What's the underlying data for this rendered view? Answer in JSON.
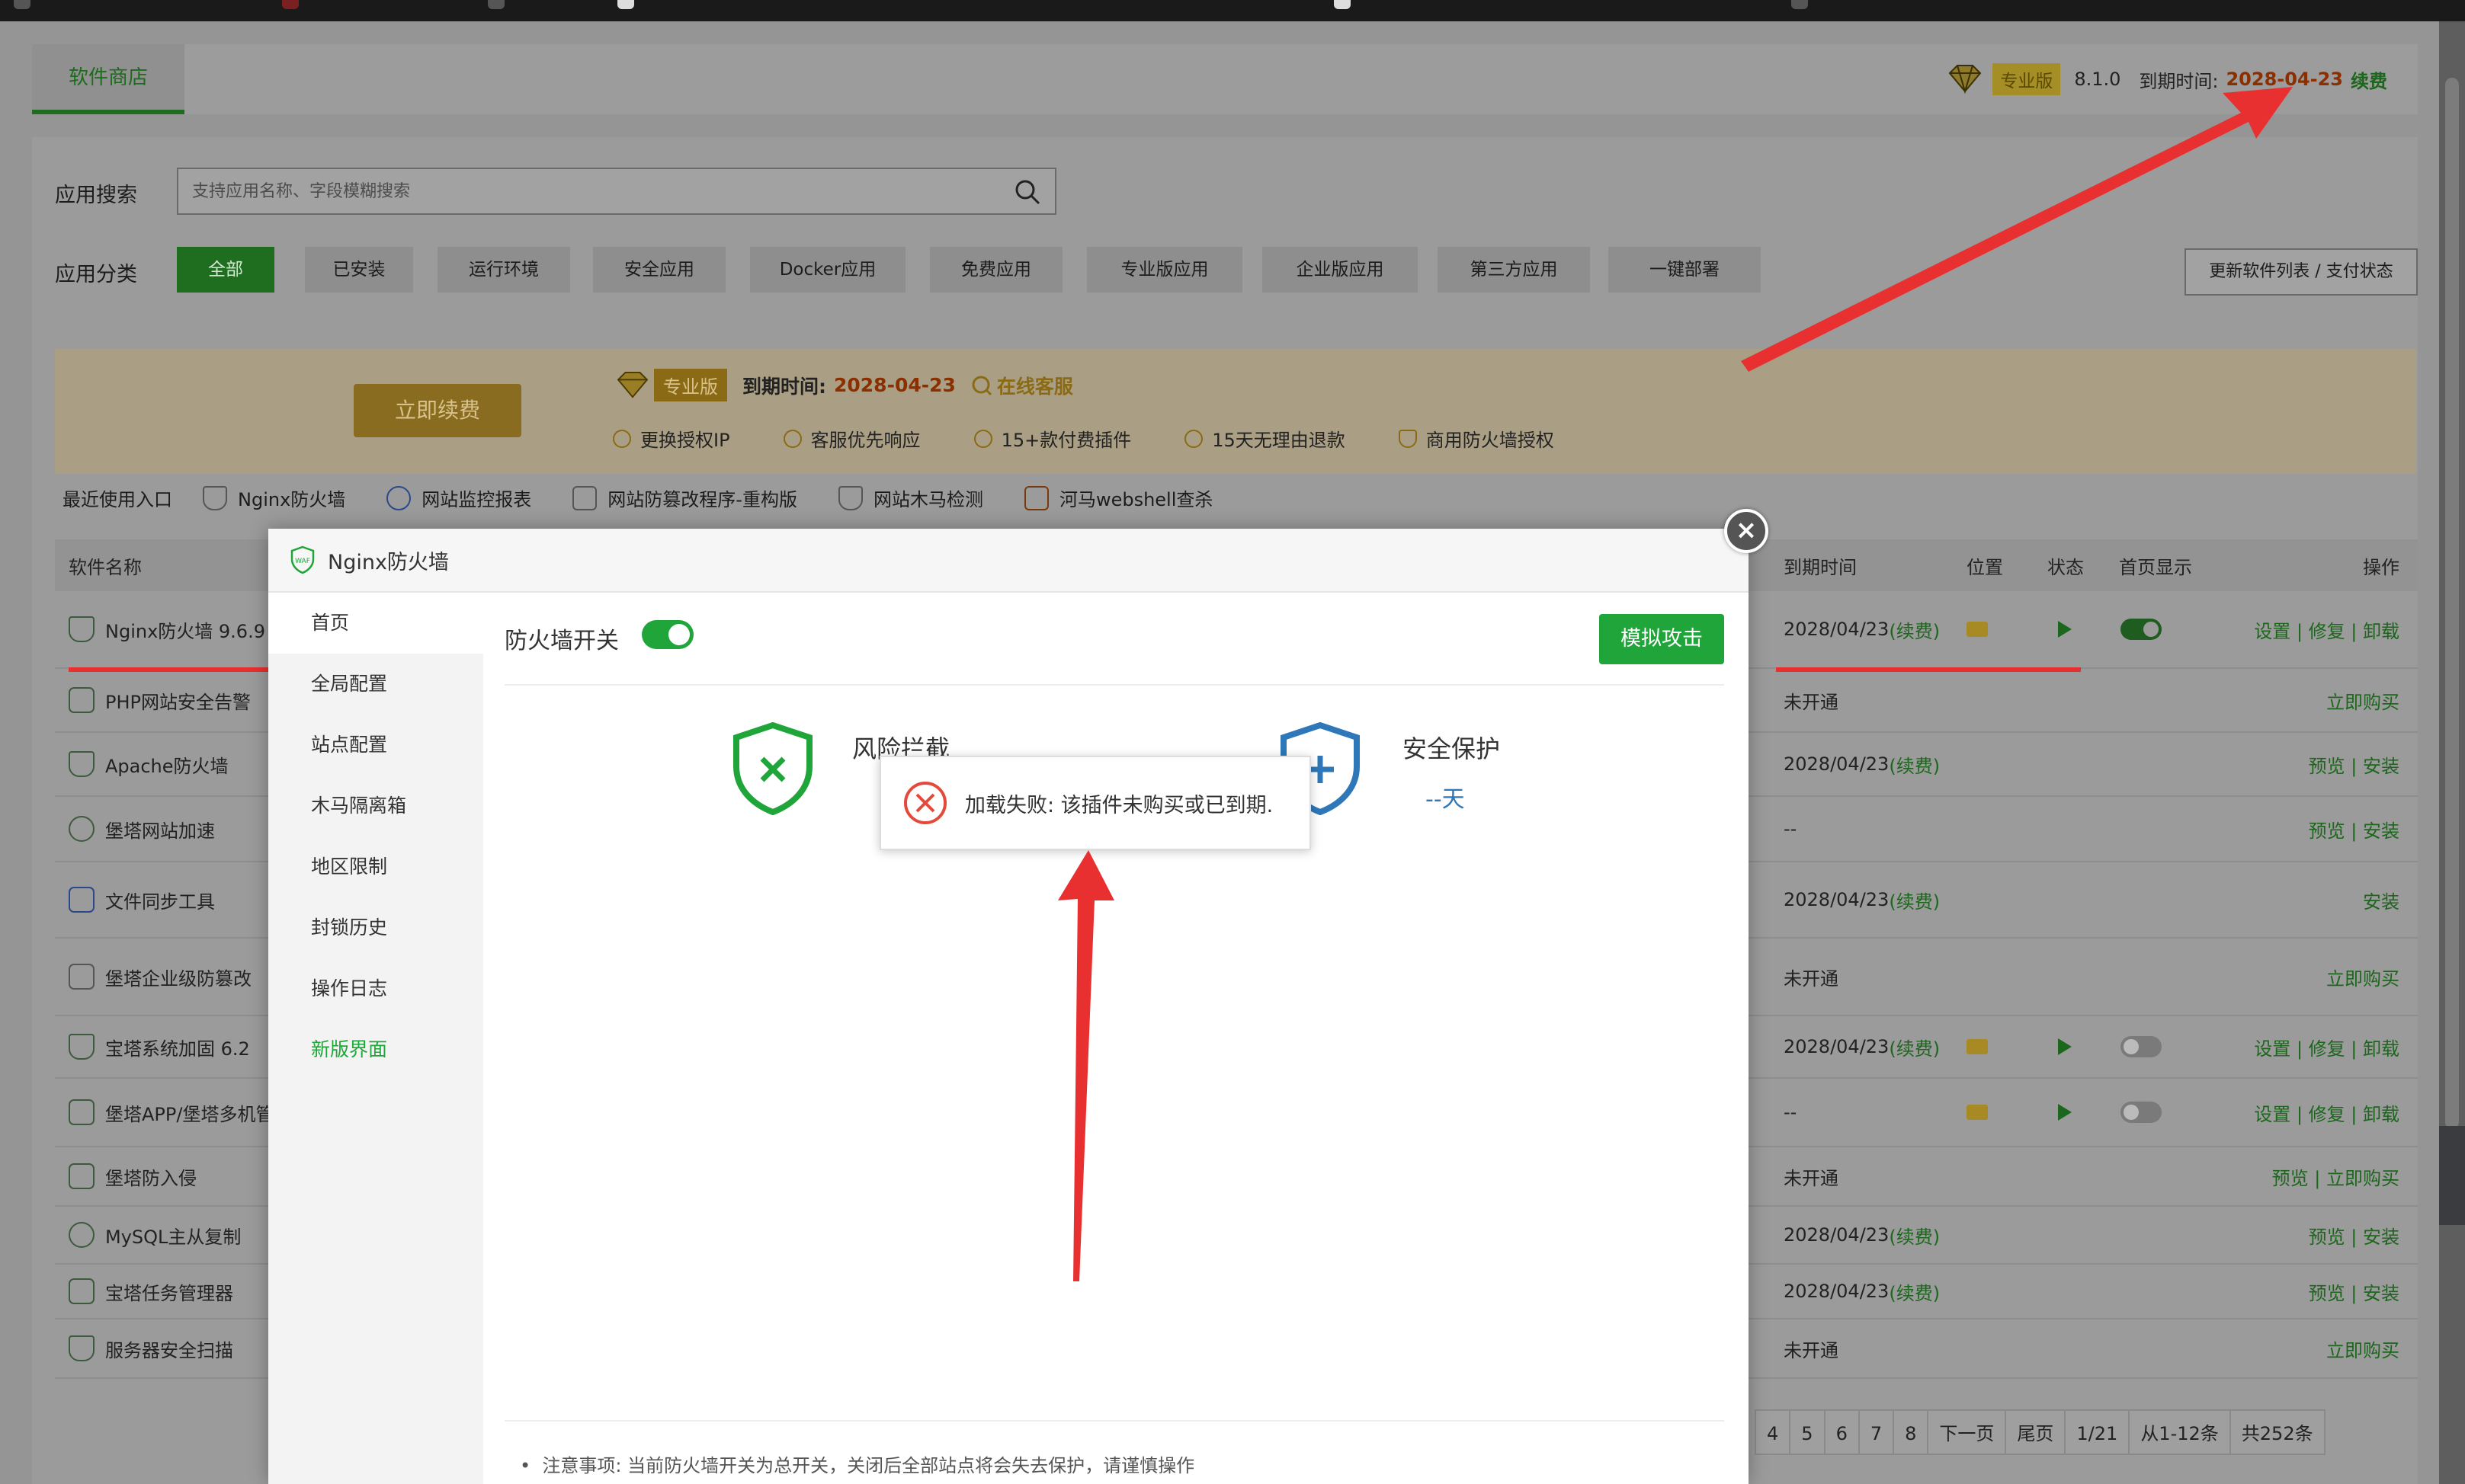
{
  "header": {
    "tab_store": "软件商店",
    "pro_badge": "专业版",
    "version": "8.1.0",
    "expire_label": "到期时间:",
    "expire_date": "2028-04-23",
    "renew": "续费"
  },
  "search": {
    "label": "应用搜索",
    "placeholder": "支持应用名称、字段模糊搜索"
  },
  "categories": {
    "label": "应用分类",
    "items": [
      "全部",
      "已安装",
      "运行环境",
      "安全应用",
      "Docker应用",
      "免费应用",
      "专业版应用",
      "企业版应用",
      "第三方应用",
      "一键部署"
    ],
    "update_button": "更新软件列表 / 支付状态"
  },
  "banner": {
    "renew_button": "立即续费",
    "pro_badge": "专业版",
    "expire_label": "到期时间:",
    "expire_date": "2028-04-23",
    "online_service": "在线客服",
    "features": [
      "更换授权IP",
      "客服优先响应",
      "15+款付费插件",
      "15天无理由退款",
      "商用防火墙授权"
    ]
  },
  "recent": {
    "label": "最近使用入口",
    "items": [
      "Nginx防火墙",
      "网站监控报表",
      "网站防篡改程序-重构版",
      "网站木马检测",
      "河马webshell查杀"
    ]
  },
  "table": {
    "headers": {
      "name": "软件名称",
      "expire": "到期时间",
      "position": "位置",
      "status": "状态",
      "home": "首页显示",
      "ops": "操作"
    },
    "rows": [
      {
        "name": "Nginx防火墙 9.6.9",
        "expire": "2028/04/23",
        "renew": "(续费)",
        "ops": "设置 | 修复 | 卸载"
      },
      {
        "name": "PHP网站安全告警",
        "expire": "未开通",
        "renew": "",
        "ops": "立即购买"
      },
      {
        "name": "Apache防火墙",
        "expire": "2028/04/23",
        "renew": "(续费)",
        "ops": "预览 | 安装"
      },
      {
        "name": "堡塔网站加速",
        "expire": "--",
        "renew": "",
        "ops": "预览 | 安装"
      },
      {
        "name": "文件同步工具",
        "expire": "2028/04/23",
        "renew": "(续费)",
        "ops": "安装"
      },
      {
        "name": "堡塔企业级防篡改",
        "expire": "未开通",
        "renew": "",
        "ops": "立即购买"
      },
      {
        "name": "宝塔系统加固 6.2",
        "expire": "2028/04/23",
        "renew": "(续费)",
        "ops": "设置 | 修复 | 卸载"
      },
      {
        "name": "堡塔APP/堡塔多机管",
        "expire": "--",
        "renew": "",
        "ops": "设置 | 修复 | 卸载"
      },
      {
        "name": "堡塔防入侵",
        "expire": "未开通",
        "renew": "",
        "ops": "预览 | 立即购买"
      },
      {
        "name": "MySQL主从复制",
        "expire": "2028/04/23",
        "renew": "(续费)",
        "ops": "预览 | 安装"
      },
      {
        "name": "宝塔任务管理器",
        "expire": "2028/04/23",
        "renew": "(续费)",
        "ops": "预览 | 安装"
      },
      {
        "name": "服务器安全扫描",
        "expire": "未开通",
        "renew": "",
        "ops": "立即购买"
      }
    ]
  },
  "pager": {
    "pages": [
      "4",
      "5",
      "6",
      "7",
      "8"
    ],
    "next": "下一页",
    "last": "尾页",
    "current": "1/21",
    "range": "从1-12条",
    "total": "共252条"
  },
  "modal": {
    "title": "Nginx防火墙",
    "close": "×",
    "sidebar": [
      "首页",
      "全局配置",
      "站点配置",
      "木马隔离箱",
      "地区限制",
      "封锁历史",
      "操作日志",
      "新版界面"
    ],
    "firewall_switch_label": "防火墙开关",
    "simulate_attack": "模拟攻击",
    "risk_label": "风险拦截",
    "safe_label": "安全保护",
    "safe_days": "--天",
    "note": "注意事项: 当前防火墙开关为总开关，关闭后全部站点将会失去保护，请谨慎操作"
  },
  "toast": {
    "message": "加载失败: 该插件未购买或已到期."
  },
  "colors": {
    "accent_green": "#20a53a",
    "annotation_red": "#e83030",
    "info_blue": "#2e77b8"
  }
}
